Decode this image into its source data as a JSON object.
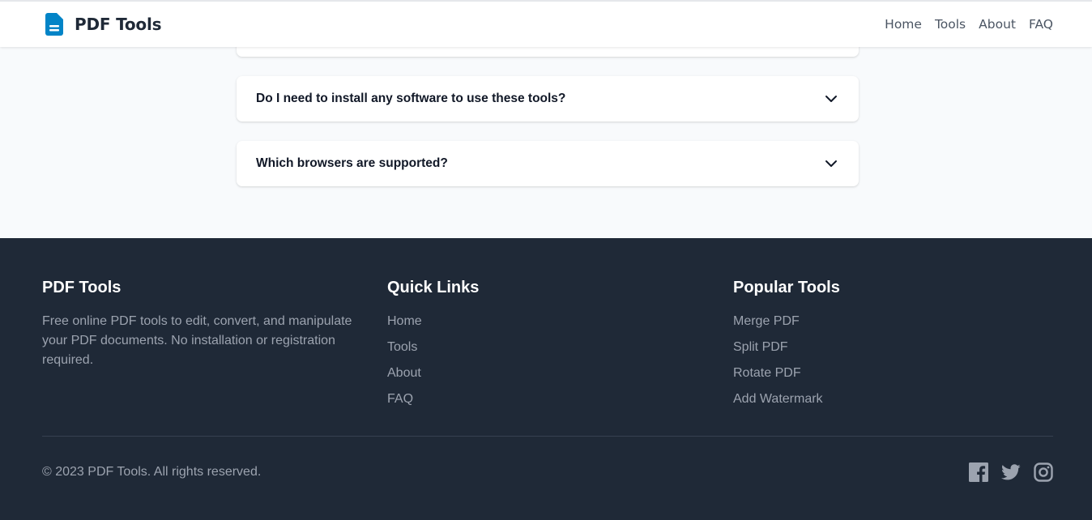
{
  "header": {
    "brand": "PDF Tools",
    "nav": [
      "Home",
      "Tools",
      "About",
      "FAQ"
    ]
  },
  "faq": {
    "items": [
      {
        "question": ""
      },
      {
        "question": "Do I need to install any software to use these tools?"
      },
      {
        "question": "Which browsers are supported?"
      }
    ]
  },
  "footer": {
    "about": {
      "title": "PDF Tools",
      "description": "Free online PDF tools to edit, convert, and manipulate your PDF documents. No installation or registration required."
    },
    "quick_links": {
      "title": "Quick Links",
      "items": [
        "Home",
        "Tools",
        "About",
        "FAQ"
      ]
    },
    "popular_tools": {
      "title": "Popular Tools",
      "items": [
        "Merge PDF",
        "Split PDF",
        "Rotate PDF",
        "Add Watermark"
      ]
    },
    "copyright": "© 2023 PDF Tools. All rights reserved.",
    "social_icons": [
      "facebook-icon",
      "twitter-icon",
      "instagram-icon"
    ]
  },
  "colors": {
    "brand_blue": "#0284c7",
    "footer_bg": "#1f2937",
    "page_bg": "#f8fafc",
    "muted_text": "#9ca3af"
  }
}
